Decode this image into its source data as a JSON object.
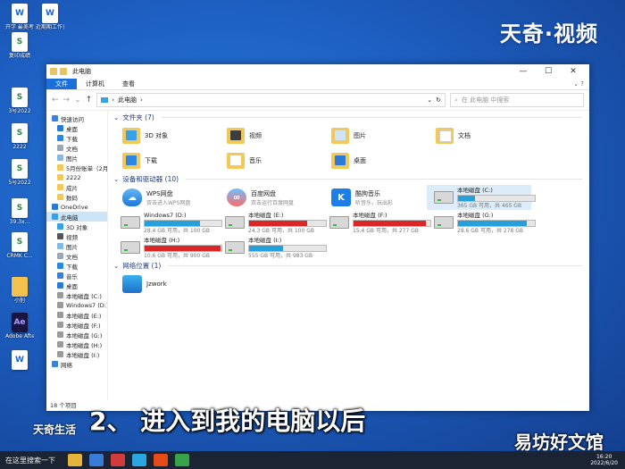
{
  "brand": "天奇·视频",
  "desktop_icons": [
    {
      "label": "开学 最美考 爱开学通...",
      "icon": "doc-icon",
      "style": "blue"
    },
    {
      "label": "近期期工作贡 文档5日...",
      "icon": "word-icon",
      "style": "blue"
    },
    {
      "label": "复印成绩",
      "icon": "excel-icon",
      "style": "green"
    },
    {
      "label": "3号2022",
      "icon": "excel-icon",
      "style": "green"
    },
    {
      "label": "2222",
      "icon": "excel-icon",
      "style": "green"
    },
    {
      "label": "5号2022",
      "icon": "excel-icon",
      "style": "green"
    },
    {
      "label": "39.3x...",
      "icon": "excel-icon",
      "style": "green"
    },
    {
      "label": "CRMK C...",
      "icon": "excel-icon",
      "style": "green"
    },
    {
      "label": "小别",
      "icon": "folder-icon",
      "style": "fold"
    },
    {
      "label": "Adobe After...",
      "icon": "ae-icon",
      "style": "ae"
    },
    {
      "label": "",
      "icon": "disc-icon",
      "style": "blue"
    }
  ],
  "window": {
    "title": "此电脑",
    "ribbon_tabs": [
      "文件",
      "计算机",
      "查看"
    ],
    "controls": {
      "minimize": "—",
      "maximize": "☐",
      "close": "✕"
    },
    "address": "此电脑",
    "search_placeholder": "在 此电脑 中搜索",
    "status": "18 个项目"
  },
  "nav_tree": [
    {
      "label": "快速访问",
      "level": 0,
      "color": "#3b82d6"
    },
    {
      "label": "桌面",
      "level": 1,
      "color": "#2b7ad8"
    },
    {
      "label": "下载",
      "level": 1,
      "color": "#2d86e0"
    },
    {
      "label": "文档",
      "level": 1,
      "color": "#9aa7b5"
    },
    {
      "label": "图片",
      "level": 1,
      "color": "#86b8e6"
    },
    {
      "label": "5月份账单（2月）",
      "level": 1,
      "color": "#f3c85a"
    },
    {
      "label": "2222",
      "level": 1,
      "color": "#f3c85a"
    },
    {
      "label": "成片",
      "level": 1,
      "color": "#f3c85a"
    },
    {
      "label": "数码",
      "level": 1,
      "color": "#f3c85a"
    },
    {
      "label": "OneDrive",
      "level": 0,
      "color": "#2b7ad8"
    },
    {
      "label": "此电脑",
      "level": 0,
      "color": "#3aa0e6",
      "selected": true
    },
    {
      "label": "3D 对象",
      "level": 1,
      "color": "#3aa0e6"
    },
    {
      "label": "视频",
      "level": 1,
      "color": "#555555"
    },
    {
      "label": "图片",
      "level": 1,
      "color": "#86b8e6"
    },
    {
      "label": "文档",
      "level": 1,
      "color": "#9aa7b5"
    },
    {
      "label": "下载",
      "level": 1,
      "color": "#2d86e0"
    },
    {
      "label": "音乐",
      "level": 1,
      "color": "#3b82d6"
    },
    {
      "label": "桌面",
      "level": 1,
      "color": "#2b7ad8"
    },
    {
      "label": "本地磁盘 (C:)",
      "level": 1,
      "color": "#9a9a9a"
    },
    {
      "label": "Windows7 (D:)",
      "level": 1,
      "color": "#9a9a9a"
    },
    {
      "label": "本地磁盘 (E:)",
      "level": 1,
      "color": "#9a9a9a"
    },
    {
      "label": "本地磁盘 (F:)",
      "level": 1,
      "color": "#9a9a9a"
    },
    {
      "label": "本地磁盘 (G:)",
      "level": 1,
      "color": "#9a9a9a"
    },
    {
      "label": "本地磁盘 (H:)",
      "level": 1,
      "color": "#9a9a9a"
    },
    {
      "label": "本地磁盘 (I:)",
      "level": 1,
      "color": "#9a9a9a"
    },
    {
      "label": "网络",
      "level": 0,
      "color": "#3b82d6"
    }
  ],
  "sections": {
    "folders": "文件夹 (7)",
    "devices": "设备和驱动器 (10)",
    "network": "网络位置 (1)"
  },
  "folders": [
    {
      "label": "3D 对象",
      "icon": "obj3d"
    },
    {
      "label": "视频",
      "icon": "video"
    },
    {
      "label": "图片",
      "icon": "pics"
    },
    {
      "label": "文档",
      "icon": "docs"
    },
    {
      "label": "下载",
      "icon": "down"
    },
    {
      "label": "音乐",
      "icon": "music"
    },
    {
      "label": "桌面",
      "icon": "desk"
    }
  ],
  "apps": [
    {
      "label": "WPS网盘",
      "sub": "双击进入WPS网盘",
      "icon": "wps",
      "glyph": "☁"
    },
    {
      "label": "百度网盘",
      "sub": "双击运行百度网盘",
      "icon": "baidu",
      "glyph": "∞"
    },
    {
      "label": "酷狗音乐",
      "sub": "听音乐，玩出彩",
      "icon": "kugou",
      "glyph": "K"
    }
  ],
  "drives": [
    {
      "label": "本地磁盘 (C:)",
      "sub": "365 GB 可用，共 465 GB",
      "used": 0.22,
      "color": "#26a0da",
      "highlight": true
    },
    {
      "label": "Windows7 (D:)",
      "sub": "28.4 GB 可用，共 100 GB",
      "used": 0.72,
      "color": "#26a0da"
    },
    {
      "label": "本地磁盘 (E:)",
      "sub": "24.3 GB 可用，共 100 GB",
      "used": 0.76,
      "color": "#da2626"
    },
    {
      "label": "本地磁盘 (F:)",
      "sub": "15.4 GB 可用，共 277 GB",
      "used": 0.94,
      "color": "#da2626"
    },
    {
      "label": "本地磁盘 (G:)",
      "sub": "28.6 GB 可用，共 278 GB",
      "used": 0.9,
      "color": "#26a0da"
    },
    {
      "label": "本地磁盘 (H:)",
      "sub": "10.6 GB 可用，共 900 GB",
      "used": 0.99,
      "color": "#da2626"
    },
    {
      "label": "本地磁盘 (I:)",
      "sub": "555 GB 可用，共 983 GB",
      "used": 0.44,
      "color": "#26a0da"
    }
  ],
  "network_items": [
    {
      "label": "Jzwork",
      "icon": "dnpp"
    }
  ],
  "caption": "2、 进入到我的电脑以后",
  "watermark_left": "天奇生活",
  "watermark_right": "易坊好文馆",
  "taskbar": {
    "start": "在这里搜索一下",
    "time": "16:20",
    "date": "2022/6/20"
  }
}
